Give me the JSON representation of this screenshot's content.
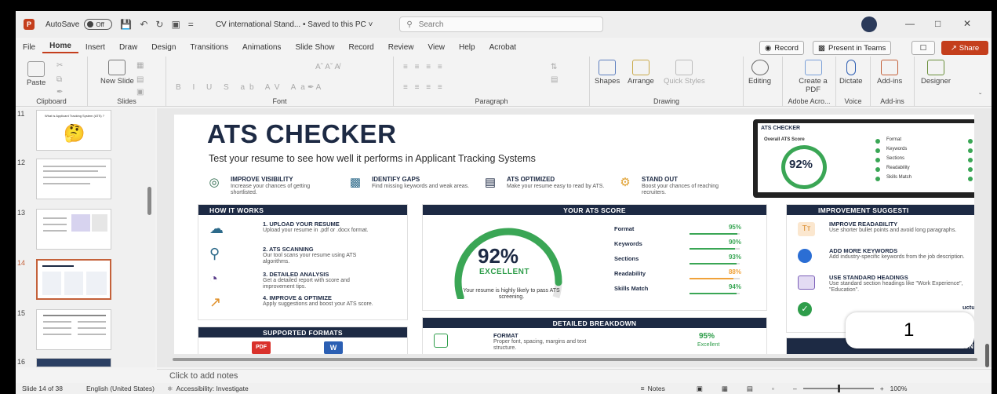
{
  "titlebar": {
    "autosave_label": "AutoSave",
    "autosave_state": "Off",
    "document_title": "CV international Stand... • Saved to this PC ˅",
    "search_placeholder": "Search"
  },
  "menu": {
    "tabs": [
      "File",
      "Home",
      "Insert",
      "Draw",
      "Design",
      "Transitions",
      "Animations",
      "Slide Show",
      "Record",
      "Review",
      "View",
      "Help",
      "Acrobat"
    ],
    "active": "Home"
  },
  "top_buttons": {
    "record": "Record",
    "present": "Present in Teams",
    "share": "Share"
  },
  "ribbon": {
    "clipboard": {
      "label": "Clipboard",
      "paste": "Paste"
    },
    "slides": {
      "label": "Slides",
      "new_slide": "New Slide"
    },
    "font": {
      "label": "Font"
    },
    "paragraph": {
      "label": "Paragraph"
    },
    "drawing": {
      "label": "Drawing",
      "shapes": "Shapes",
      "arrange": "Arrange",
      "quick_styles": "Quick Styles"
    },
    "editing": {
      "label": "Editing"
    },
    "adobe": {
      "label": "Adobe Acro...",
      "create_pdf": "Create a PDF"
    },
    "voice": {
      "label": "Voice",
      "dictate": "Dictate"
    },
    "addins": {
      "label": "Add-ins",
      "addins": "Add-ins"
    },
    "designer": {
      "label": "Designer"
    }
  },
  "thumbnails": [
    "11",
    "12",
    "13",
    "14",
    "15",
    "16"
  ],
  "thumb11_title": "What is Applicant Tracking System (ATS) ?",
  "slide": {
    "title": "ATS CHECKER",
    "subtitle": "Test your resume to see how well it performs in Applicant Tracking Systems",
    "features": [
      {
        "title": "IMPROVE VISIBILITY",
        "desc": "Increase your chances of getting shortlisted."
      },
      {
        "title": "IDENTIFY GAPS",
        "desc": "Find missing keywords and weak areas."
      },
      {
        "title": "ATS OPTIMIZED",
        "desc": "Make your resume easy to read by ATS."
      },
      {
        "title": "STAND OUT",
        "desc": "Boost your chances of reaching recruiters."
      }
    ],
    "laptop": {
      "title": "ATS CHECKER",
      "overall": "Overall ATS Score",
      "score": "92%",
      "items": [
        "Format",
        "Keywords",
        "Sections",
        "Readability",
        "Skills Match"
      ]
    },
    "how_it_works": {
      "header": "HOW IT WORKS",
      "steps": [
        {
          "title": "1. UPLOAD YOUR RESUME",
          "desc": "Upload your resume in .pdf or .docx format."
        },
        {
          "title": "2. ATS SCANNING",
          "desc": "Our tool scans your resume using ATS algorithms."
        },
        {
          "title": "3. DETAILED ANALYSIS",
          "desc": "Get a detailed report with score and improvement tips."
        },
        {
          "title": "4. IMPROVE & OPTIMIZE",
          "desc": "Apply suggestions and boost your ATS score."
        }
      ]
    },
    "supported": {
      "header": "SUPPORTED FORMATS",
      "pdf": "PDF",
      "word": "W"
    },
    "ats_score": {
      "header": "YOUR ATS SCORE",
      "score": "92%",
      "score_fraction": 0.92,
      "rating": "EXCELLENT",
      "note": "Your resume is highly likely to pass ATS screening.",
      "metrics": [
        {
          "label": "Format",
          "value": "95%",
          "fraction": 0.95,
          "color": "#3aa655"
        },
        {
          "label": "Keywords",
          "value": "90%",
          "fraction": 0.9,
          "color": "#3aa655"
        },
        {
          "label": "Sections",
          "value": "93%",
          "fraction": 0.93,
          "color": "#3aa655"
        },
        {
          "label": "Readability",
          "value": "88%",
          "fraction": 0.88,
          "color": "#f0a23a"
        },
        {
          "label": "Skills Match",
          "value": "94%",
          "fraction": 0.94,
          "color": "#3aa655"
        }
      ]
    },
    "breakdown": {
      "header": "DETAILED BREAKDOWN",
      "item_title": "FORMAT",
      "item_desc": "Proper font, spacing, margins and text structure.",
      "item_value": "95%",
      "item_rating": "Excellent"
    },
    "improvement": {
      "header": "IMPROVEMENT SUGGESTI",
      "items": [
        {
          "title": "IMPROVE READABILITY",
          "desc": "Use shorter bullet points and avoid long paragraphs."
        },
        {
          "title": "ADD MORE KEYWORDS",
          "desc": "Add industry-specific keywords from the job description."
        },
        {
          "title": "USE STANDARD HEADINGS",
          "desc": "Use standard section headings like \"Work Experience\", \"Education\"."
        },
        {
          "title": "",
          "desc": ""
        }
      ],
      "partial_text": "uctu",
      "partial_header": "SS FOUN"
    },
    "popup_value": "1"
  },
  "notes_placeholder": "Click to add notes",
  "status": {
    "slide_counter": "Slide 14 of 38",
    "language": "English (United States)",
    "accessibility": "Accessibility: Investigate",
    "notes": "Notes",
    "zoom": "100%"
  }
}
